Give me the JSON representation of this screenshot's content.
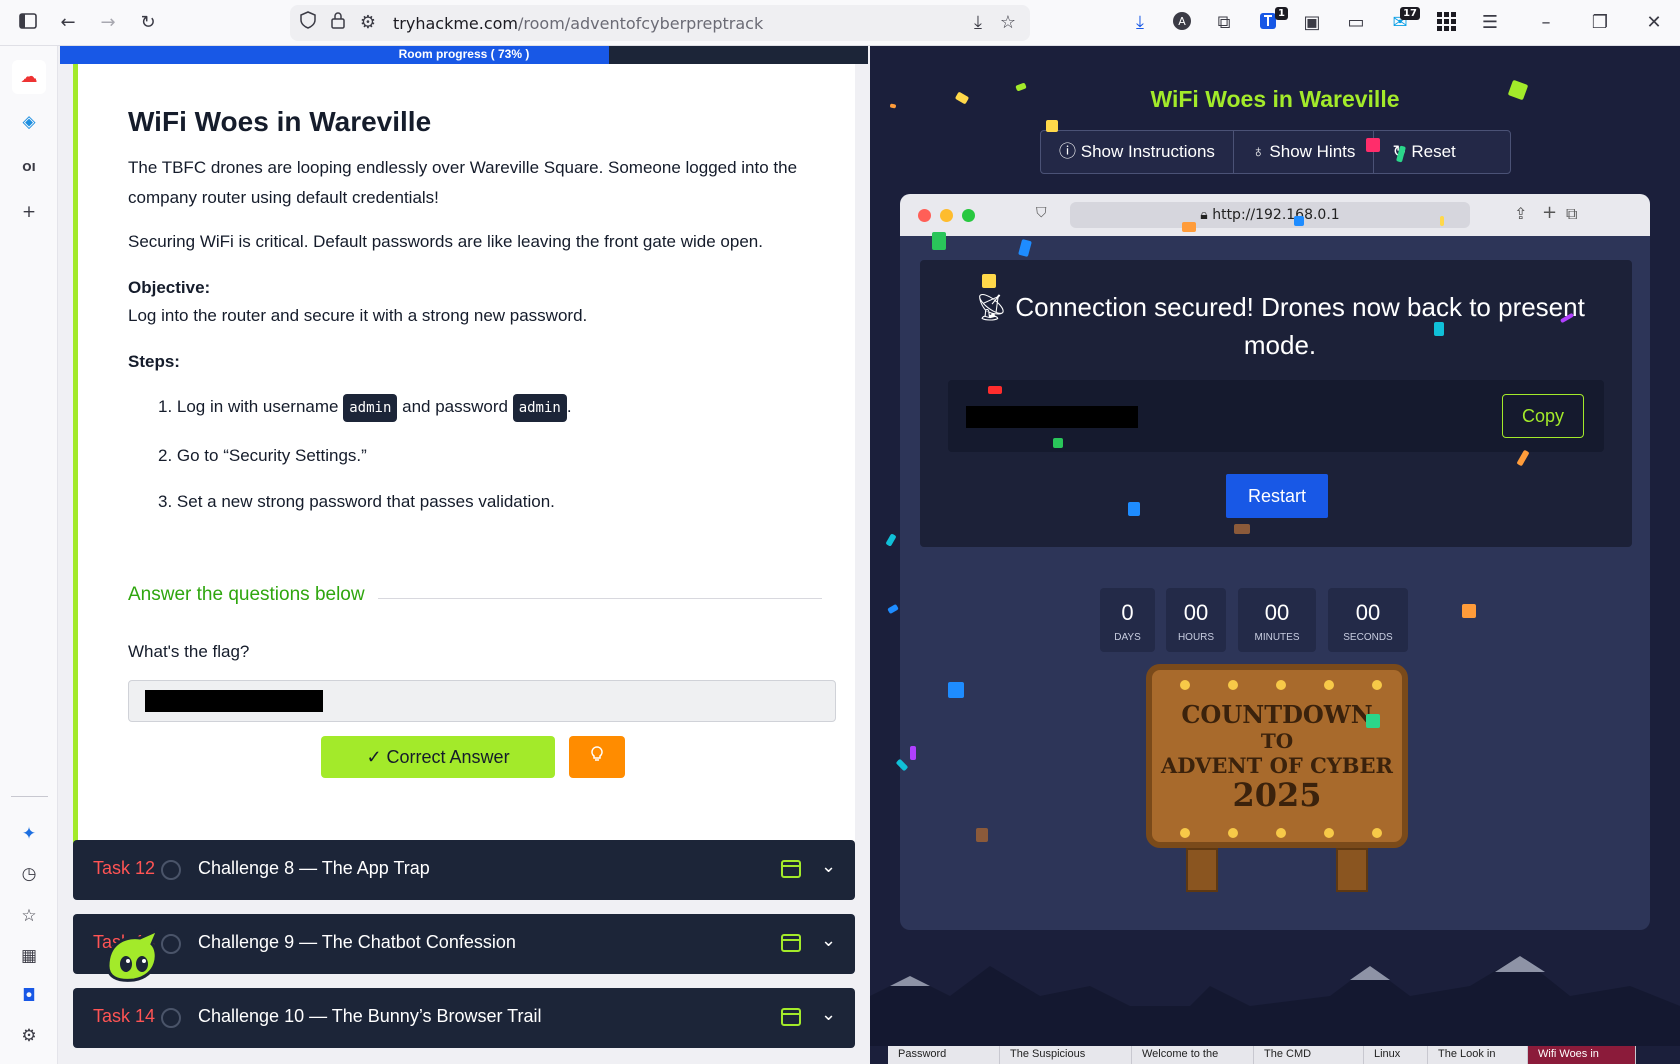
{
  "browser": {
    "url_host": "tryhackme.com",
    "url_path": "/room/adventofcyberpreptrack",
    "extension_badge_1": "1",
    "extension_badge_2": "17"
  },
  "room": {
    "progress_label": "Room progress ( 73% )",
    "progress_percent": 73
  },
  "task": {
    "title": "WiFi Woes in Wareville",
    "intro": "The TBFC drones are looping endlessly over Wareville Square. Someone logged into the company router using default credentials!",
    "warning": "Securing WiFi is critical. Default passwords are like leaving the front gate wide open.",
    "objective_label": "Objective:",
    "objective_text": "Log into the router and secure it with a strong new password.",
    "steps_label": "Steps:",
    "step1_prefix": "1. Log in with username",
    "step1_code_user": "admin",
    "step1_middle": "and password",
    "step1_code_pass": "admin",
    "step1_suffix": ".",
    "step2": "2. Go to “Security Settings.”",
    "step3": "3. Set a new strong password that passes validation.",
    "answer_heading": "Answer the questions below",
    "question": "What's the flag?",
    "correct_label": "✓  Correct Answer"
  },
  "tasks": [
    {
      "num": "Task 12",
      "title": "Challenge 8 — The App Trap"
    },
    {
      "num": "Task 13",
      "title": "Challenge 9 — The Chatbot Confession"
    },
    {
      "num": "Task 14",
      "title": "Challenge 10 — The Bunny’s Browser Trail"
    }
  ],
  "sim": {
    "title": "WiFi Woes in Wareville",
    "show_instructions": "Show Instructions",
    "show_hints": "Show Hints",
    "reset": "Reset",
    "url": "http://192.168.0.1",
    "message": "Connection secured! Drones now back to present mode.",
    "copy_label": "Copy",
    "restart_label": "Restart",
    "countdown": [
      {
        "value": "0",
        "label": "DAYS"
      },
      {
        "value": "00",
        "label": "HOURS"
      },
      {
        "value": "00",
        "label": "MINUTES"
      },
      {
        "value": "00",
        "label": "SECONDS"
      }
    ],
    "sign_line1": "COUNTDOWN",
    "sign_line2": "TO",
    "sign_line3": "ADVENT OF CYBER",
    "sign_line4": "2025"
  },
  "bottom_tabs": [
    "Password",
    "The Suspicious",
    "Welcome to the",
    "The CMD",
    "Linux",
    "The Look in",
    "Wifi Woes in"
  ],
  "colors": {
    "accent_green": "#a3ea2a",
    "task_red": "#ff5454",
    "dark_navy": "#1c2538",
    "primary_blue": "#1858e6",
    "hint_orange": "#ff8c00"
  }
}
